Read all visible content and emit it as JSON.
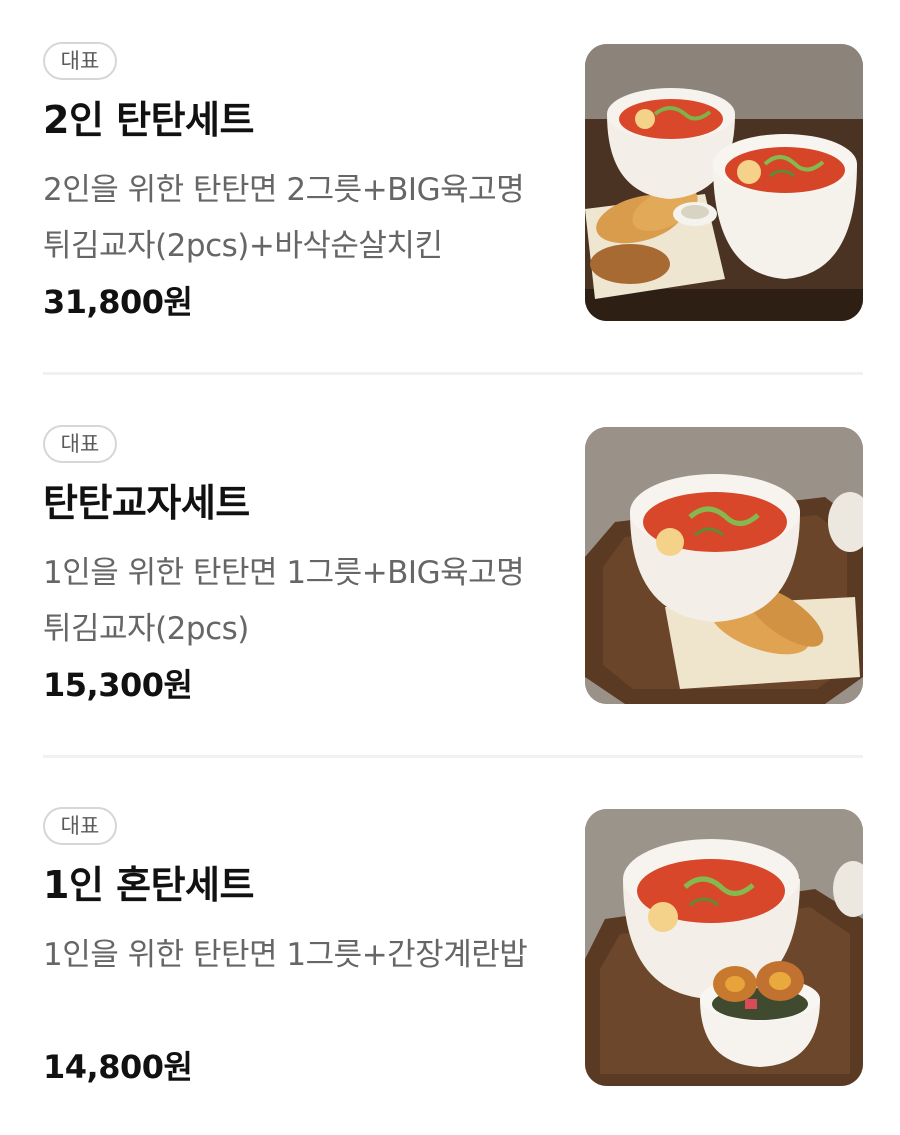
{
  "menu": {
    "items": [
      {
        "badge": "대표",
        "title": "2인 탄탄세트",
        "description": "2인을 위한 탄탄면 2그릇+BIG육고명튀김교자(2pcs)+바삭순살치킨",
        "price": "31,800원",
        "image": "tantan-set-for-two-photo"
      },
      {
        "badge": "대표",
        "title": "탄탄교자세트",
        "description": "1인을 위한 탄탄면 1그릇+BIG육고명튀김교자(2pcs)",
        "price": "15,300원",
        "image": "tantan-gyoza-set-photo"
      },
      {
        "badge": "대표",
        "title": "1인 혼탄세트",
        "description": "1인을 위한 탄탄면 1그릇+간장계란밥",
        "price": "14,800원",
        "image": "solo-tantan-set-photo"
      }
    ]
  }
}
